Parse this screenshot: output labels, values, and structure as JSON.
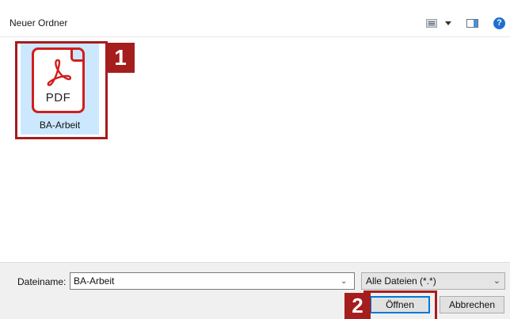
{
  "window": {
    "breadcrumb": "Neuer Ordner"
  },
  "toolbar": {
    "view_icon": "view-details-icon",
    "view_menu_icon": "chevron-down-icon",
    "preview_pane_icon": "preview-pane-icon",
    "help_label": "?"
  },
  "files": [
    {
      "name": "BA-Arbeit",
      "type_label": "PDF",
      "icon": "acrobat-pdf-icon",
      "selected": true
    }
  ],
  "bottom": {
    "filename_label": "Dateiname:",
    "filename_value": "BA-Arbeit",
    "filetype_value": "Alle Dateien (*.*)",
    "open_label": "Öffnen",
    "cancel_label": "Abbrechen"
  },
  "annotations": {
    "step1": "1",
    "step2": "2"
  },
  "colors": {
    "selection": "#cce8ff",
    "pdf_red": "#d11e1e",
    "annotation_red": "#a51d1d",
    "default_button_border": "#0078d7",
    "help_blue": "#1f6fd1"
  }
}
